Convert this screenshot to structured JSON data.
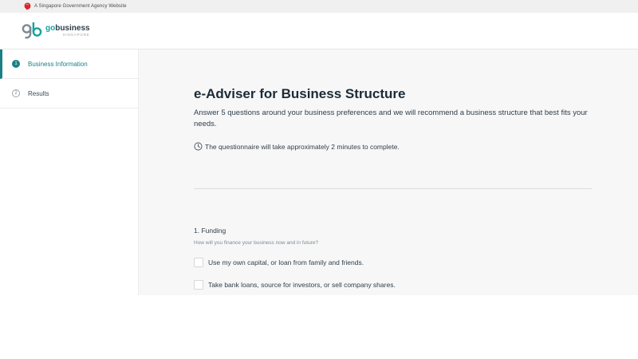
{
  "masthead": {
    "text": "A Singapore Government Agency Website",
    "icon": "lion-head-icon",
    "icon_color": "#d9252a"
  },
  "header": {
    "logo_go": "go",
    "logo_business": "business",
    "logo_sub": "SINGAPORE",
    "brand_color": "#16a2a1"
  },
  "sidebar": {
    "steps": [
      {
        "number": "1",
        "label": "Business Information",
        "active": true
      },
      {
        "number": "2",
        "label": "Results",
        "active": false
      }
    ],
    "accent_color": "#1a7f86"
  },
  "main": {
    "title": "e-Adviser for Business Structure",
    "description": "Answer 5 questions around your business preferences and we will recommend a business structure that best fits your needs.",
    "time_note": "The questionnaire will take approximately 2 minutes to complete.",
    "time_icon": "clock-icon",
    "question": {
      "title": "1. Funding",
      "subtitle": "How will you finance your business now and in future?",
      "options": [
        {
          "label": "Use my own capital, or loan from family and friends.",
          "checked": false
        },
        {
          "label": "Take bank loans, source for investors, or sell company shares.",
          "checked": false
        }
      ]
    }
  }
}
